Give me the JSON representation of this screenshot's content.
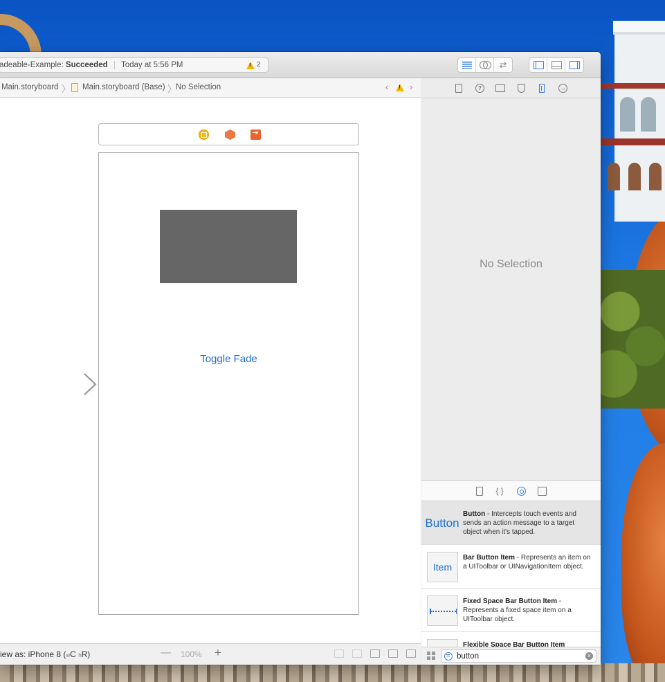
{
  "toolbar": {
    "project": "adeable-Example: ",
    "build_status": "Succeeded",
    "timestamp": "Today at 5:56 PM",
    "warning_count": "2"
  },
  "jumpbar": {
    "crumbs": [
      "Main.storyboard",
      "Main.storyboard (Base)",
      "No Selection"
    ]
  },
  "canvas": {
    "button_title": "Toggle Fade"
  },
  "editor_bottom": {
    "view_as_prefix": "iew as: iPhone 8 (",
    "size_w": "w",
    "size_w_val": "C",
    "size_h": "h",
    "size_h_val": "R)",
    "zoom": "100%",
    "zoom_out": "—",
    "zoom_in": "+"
  },
  "inspector": {
    "empty_text": "No Selection"
  },
  "library": {
    "items": [
      {
        "thumb": "Button",
        "title": "Button",
        "desc": " - Intercepts touch events and sends an action message to a target object when it's tapped."
      },
      {
        "thumb": "Item",
        "title": "Bar Button Item",
        "desc": " - Represents an item on a UIToolbar or UINavigationItem object."
      },
      {
        "thumb": "",
        "title": "Fixed Space Bar Button Item",
        "desc": " - Represents a fixed space item on a UIToolbar object."
      },
      {
        "thumb": "",
        "title": "Flexible Space Bar Button Item",
        "desc": ""
      }
    ],
    "filter_value": "button"
  },
  "colors": {
    "accent": "#1a6fd0",
    "warning": "#f2b705",
    "placeholder_view": "#666666"
  },
  "icons": [
    "warning-icon",
    "editor-standard-icon",
    "editor-assistant-icon",
    "editor-version-icon",
    "navigator-toggle-icon",
    "debug-area-toggle-icon",
    "utilities-toggle-icon",
    "file-inspector-icon",
    "quick-help-icon",
    "identity-inspector-icon",
    "attributes-inspector-icon",
    "size-inspector-icon",
    "connections-inspector-icon",
    "file-template-icon",
    "code-snippet-icon",
    "object-library-icon",
    "media-library-icon",
    "grid-view-icon",
    "filter-icon",
    "clear-icon"
  ]
}
